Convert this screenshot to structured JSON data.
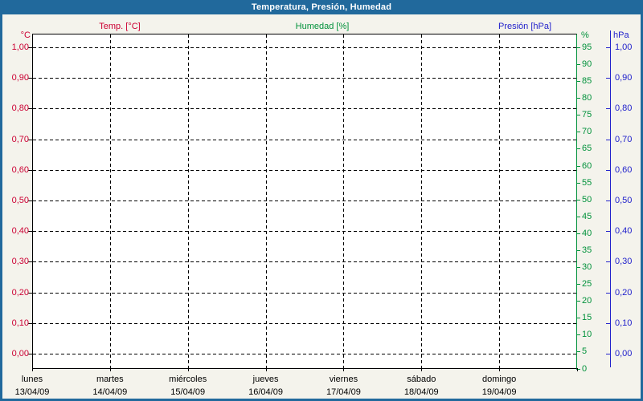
{
  "window": {
    "title": "Temperatura, Presión, Humedad",
    "titlebar_color": "#21699c",
    "border_color": "#21699c",
    "background_color": "#f4f3ec"
  },
  "legend": [
    {
      "label": "Temp. [°C]",
      "color": "#cc0033"
    },
    {
      "label": "Humedad [%]",
      "color": "#00913a"
    },
    {
      "label": "Presión [hPa]",
      "color": "#2222cc"
    }
  ],
  "chart_data": {
    "type": "line",
    "title": "Temperatura, Presión, Humedad",
    "grid": true,
    "grid_style": "dashed-black",
    "plot_background": "#ffffff",
    "series": [
      {
        "name": "Temp. [°C]",
        "axis": "temp_c",
        "color": "#cc0033",
        "values": []
      },
      {
        "name": "Humedad [%]",
        "axis": "humidity_pct",
        "color": "#00913a",
        "values": []
      },
      {
        "name": "Presión [hPa]",
        "axis": "pressure_hpa",
        "color": "#2222cc",
        "values": []
      }
    ],
    "axes": {
      "temp_c": {
        "side": "left",
        "unit": "°C",
        "color": "#cc0033",
        "min": 0.0,
        "max": 1.0,
        "tick_step": 0.1,
        "tick_labels": [
          "1,00",
          "0,90",
          "0,80",
          "0,70",
          "0,60",
          "0,50",
          "0,40",
          "0,30",
          "0,20",
          "0,10",
          "0,00"
        ]
      },
      "humidity_pct": {
        "side": "right",
        "unit": "%",
        "color": "#00913a",
        "min": 0,
        "max": 95,
        "tick_step": 5,
        "tick_labels": [
          "95",
          "90",
          "85",
          "80",
          "75",
          "70",
          "65",
          "60",
          "55",
          "50",
          "45",
          "40",
          "35",
          "30",
          "25",
          "20",
          "15",
          "10",
          "5",
          "0"
        ]
      },
      "pressure_hpa": {
        "side": "right-outer",
        "unit": "hPa",
        "color": "#2222cc",
        "min": 0.0,
        "max": 1.0,
        "tick_step": 0.1,
        "tick_labels": [
          "1,00",
          "0,90",
          "0,80",
          "0,70",
          "0,60",
          "0,50",
          "0,40",
          "0,30",
          "0,20",
          "0,10",
          "0,00"
        ]
      }
    },
    "x_axis": {
      "categories": [
        {
          "day": "lunes",
          "date": "13/04/09"
        },
        {
          "day": "martes",
          "date": "14/04/09"
        },
        {
          "day": "miércoles",
          "date": "15/04/09"
        },
        {
          "day": "jueves",
          "date": "16/04/09"
        },
        {
          "day": "viernes",
          "date": "17/04/09"
        },
        {
          "day": "sábado",
          "date": "18/04/09"
        },
        {
          "day": "domingo",
          "date": "19/04/09"
        }
      ]
    }
  }
}
